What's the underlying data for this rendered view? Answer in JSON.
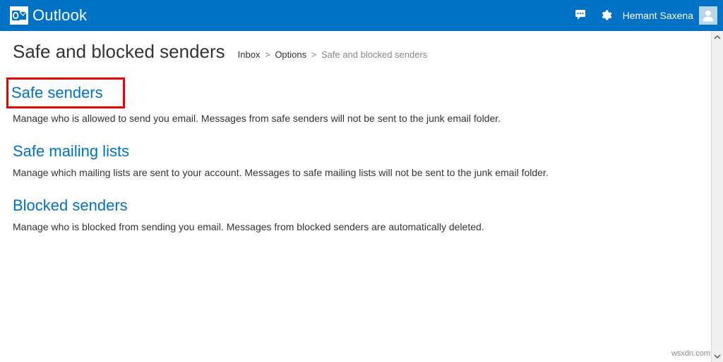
{
  "header": {
    "brand": "Outlook",
    "user_name": "Hemant Saxena"
  },
  "page": {
    "title": "Safe and blocked senders"
  },
  "breadcrumb": {
    "items": [
      "Inbox",
      "Options",
      "Safe and blocked senders"
    ],
    "separator": ">"
  },
  "sections": [
    {
      "title": "Safe senders",
      "desc": "Manage who is allowed to send you email. Messages from safe senders will not be sent to the junk email folder."
    },
    {
      "title": "Safe mailing lists",
      "desc": "Manage which mailing lists are sent to your account. Messages to safe mailing lists will not be sent to the junk email folder."
    },
    {
      "title": "Blocked senders",
      "desc": "Manage who is blocked from sending you email. Messages from blocked senders are automatically deleted."
    }
  ],
  "watermark": "wsxdn.com"
}
